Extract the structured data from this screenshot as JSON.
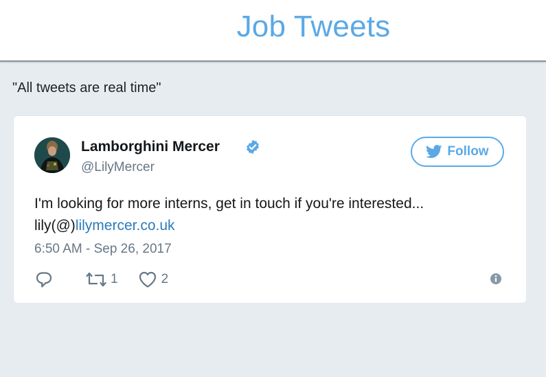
{
  "header": {
    "title": "Job Tweets"
  },
  "subtitle": "\"All tweets are real time\"",
  "tweet": {
    "display_name": "Lamborghini Mercer",
    "handle": "@LilyMercer",
    "follow_label": "Follow",
    "text_prefix": "I'm looking for more interns, get in touch if you're interested... lily(@)",
    "link_text": "lilymercer.co.uk",
    "timestamp": "6:50 AM - Sep 26, 2017",
    "retweet_count": "1",
    "like_count": "2",
    "icons": {
      "avatar": "avatar",
      "verified": "verified-badge-icon",
      "follow": "twitter-bird-icon",
      "reply": "reply-icon",
      "retweet": "retweet-icon",
      "like": "heart-icon",
      "info": "info-icon"
    }
  },
  "colors": {
    "accent": "#5aa9e6",
    "link": "#2b7bb9",
    "muted": "#657786",
    "page_background": "#e6ecf0"
  }
}
